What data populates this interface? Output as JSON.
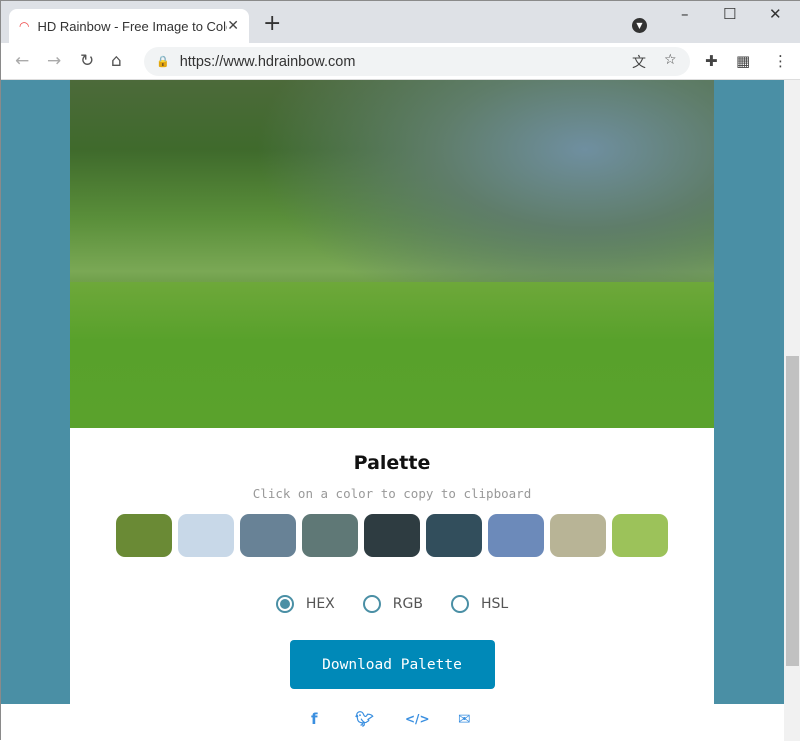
{
  "browser": {
    "tab_title": "HD Rainbow - Free Image to Color Palette Generator",
    "url": "https://www.hdrainbow.com"
  },
  "palette": {
    "title": "Palette",
    "subtitle": "Click on a color to copy to clipboard",
    "colors": [
      "#6a8a35",
      "#c8d8e8",
      "#688296",
      "#5f7876",
      "#2e3c41",
      "#324e5c",
      "#6c8aba",
      "#b8b496",
      "#9cc25a"
    ],
    "formats": [
      {
        "label": "HEX",
        "selected": true
      },
      {
        "label": "RGB",
        "selected": false
      },
      {
        "label": "HSL",
        "selected": false
      }
    ],
    "download_label": "Download Palette"
  },
  "share_icons": [
    "facebook-icon",
    "twitter-icon",
    "embed-code-icon",
    "email-icon"
  ],
  "accent": "#0089b8",
  "page_bg": "#4a8fa5"
}
